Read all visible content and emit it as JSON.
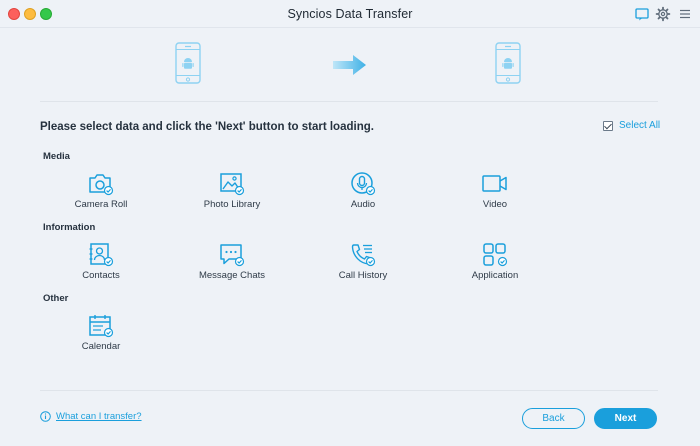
{
  "window": {
    "title": "Syncios Data Transfer"
  },
  "titlebar_icons": [
    "feedback-icon",
    "gear-icon",
    "menu-icon"
  ],
  "transfer": {
    "source_icon": "android-phone-icon",
    "direction_icon": "arrow-right-icon",
    "target_icon": "android-phone-icon"
  },
  "instruction": "Please select data and click the 'Next' button to start loading.",
  "select_all": {
    "label": "Select All",
    "checked": true
  },
  "sections": {
    "media": {
      "label": "Media",
      "items": [
        {
          "label": "Camera Roll",
          "icon": "camera-icon",
          "checked": true
        },
        {
          "label": "Photo Library",
          "icon": "photo-icon",
          "checked": true
        },
        {
          "label": "Audio",
          "icon": "microphone-icon",
          "checked": true
        },
        {
          "label": "Video",
          "icon": "video-camera-icon",
          "checked": false
        }
      ]
    },
    "information": {
      "label": "Information",
      "items": [
        {
          "label": "Contacts",
          "icon": "contacts-icon",
          "checked": true
        },
        {
          "label": "Message Chats",
          "icon": "chat-icon",
          "checked": true
        },
        {
          "label": "Call History",
          "icon": "phone-icon",
          "checked": true
        },
        {
          "label": "Application",
          "icon": "apps-grid-icon",
          "checked": true
        }
      ]
    },
    "other": {
      "label": "Other",
      "items": [
        {
          "label": "Calendar",
          "icon": "calendar-icon",
          "checked": true
        }
      ]
    }
  },
  "footer": {
    "help_link": "What can I transfer?",
    "back_label": "Back",
    "next_label": "Next"
  },
  "colors": {
    "accent": "#1a9fdc",
    "icon_light": "#8ed2f2",
    "background": "#eef2f7",
    "check_grey": "#9aa7b4"
  }
}
